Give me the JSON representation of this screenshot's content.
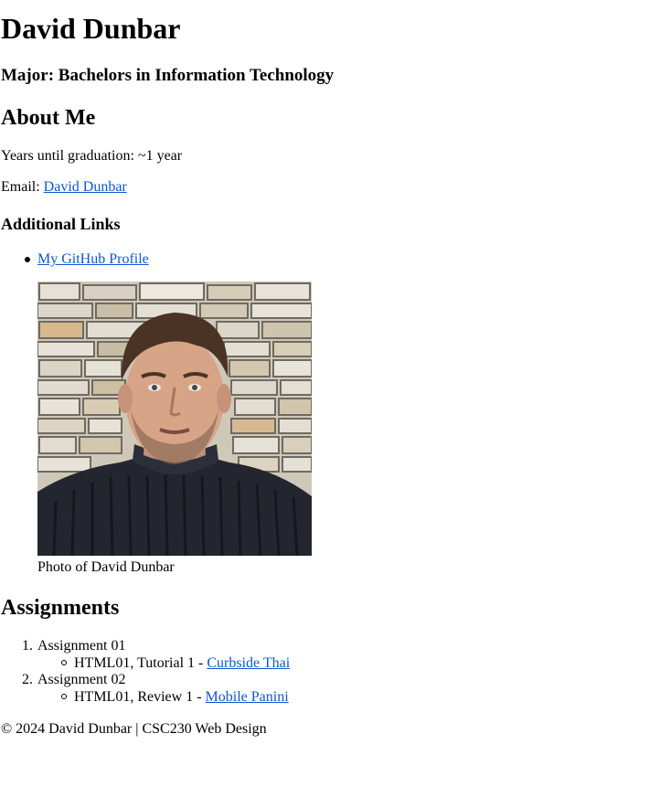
{
  "header": {
    "name": "David Dunbar",
    "major": "Major: Bachelors in Information Technology"
  },
  "about": {
    "heading": "About Me",
    "years_text": "Years until graduation: ~1 year",
    "email_label": "Email:",
    "email_link": "David Dunbar"
  },
  "links": {
    "heading": "Additional Links",
    "items": [
      {
        "label": "My GitHub Profile"
      }
    ]
  },
  "photo": {
    "caption": "Photo of David Dunbar"
  },
  "assignments": {
    "heading": "Assignments",
    "items": [
      {
        "number": "1.",
        "title": "Assignment 01",
        "sub_prefix": "HTML01, Tutorial 1 -",
        "sub_link": "Curbside Thai"
      },
      {
        "number": "2.",
        "title": "Assignment 02",
        "sub_prefix": "HTML01, Review 1 -",
        "sub_link": "Mobile Panini"
      }
    ]
  },
  "footer": {
    "text": "© 2024 David Dunbar | CSC230 Web Design"
  }
}
